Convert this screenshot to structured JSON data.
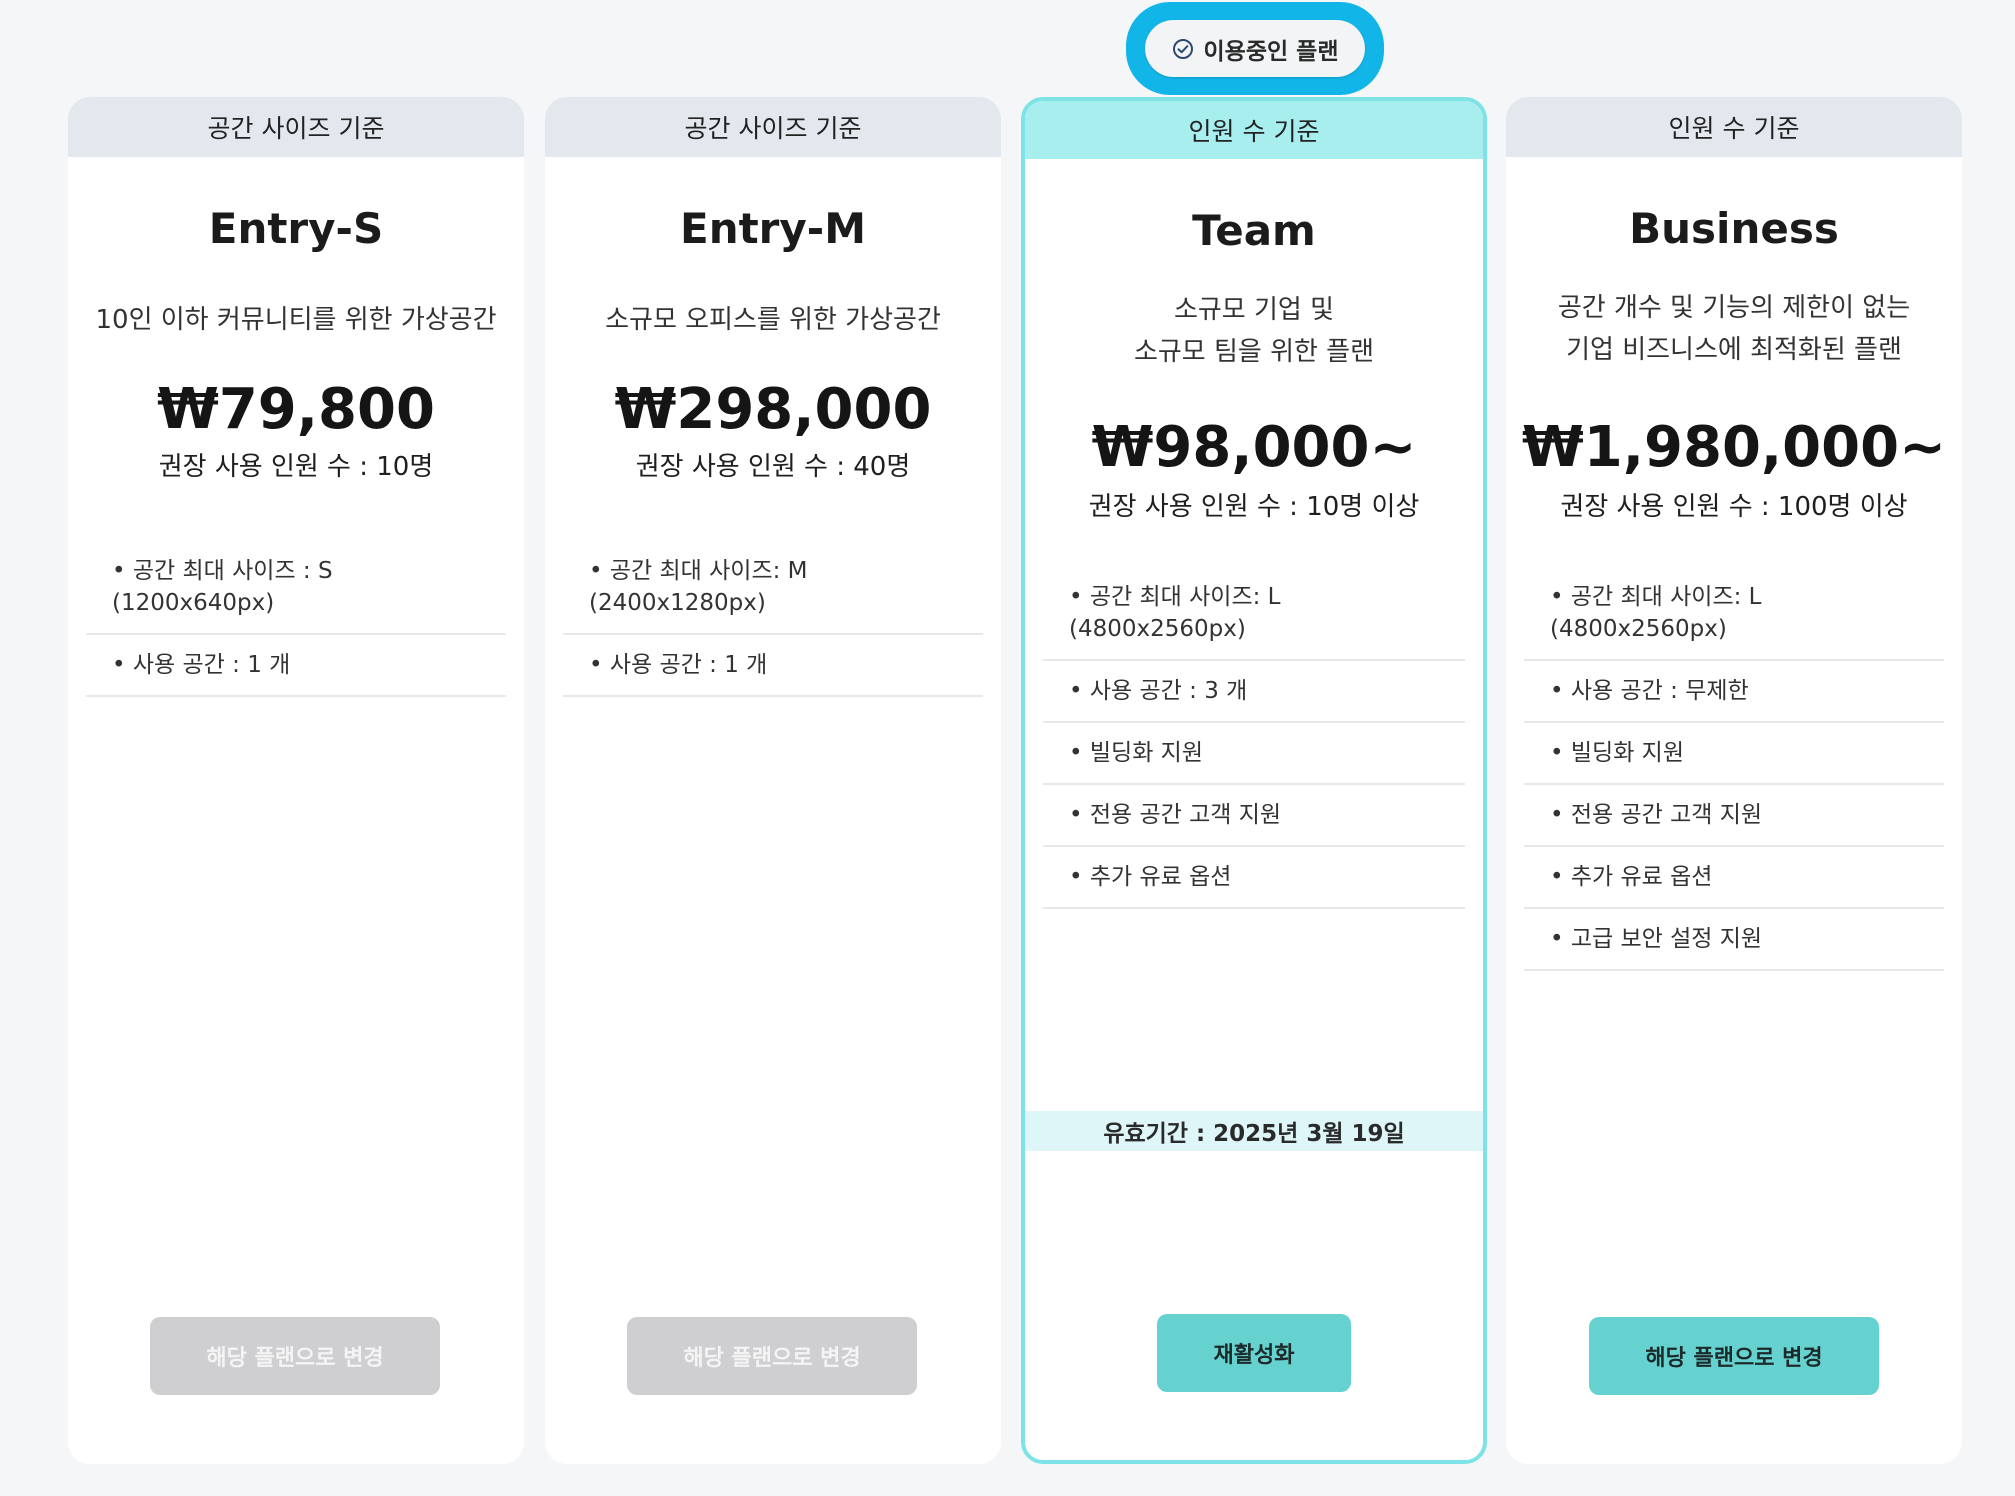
{
  "current_badge": {
    "label": "이용중인 플랜",
    "icon": "check-circle-icon"
  },
  "colors": {
    "accent": "#66d2d0",
    "active_border": "#7ee3e6",
    "badge_highlight": "#12b5e8",
    "header_default": "#e3e8ee",
    "header_active": "#a8eeee",
    "button_disabled": "#cfcfd2"
  },
  "plans": [
    {
      "category": "공간 사이즈 기준",
      "name": "Entry-S",
      "description": "10인 이하 커뮤니티를 위한 가상공간",
      "price": "₩79,800",
      "recommended": "권장 사용 인원 수 : 10명",
      "features": [
        "• 공간 최대 사이즈 : S\n(1200x640px)",
        "• 사용 공간 :  1 개"
      ],
      "button": {
        "label": "해당 플랜으로 변경",
        "state": "disabled"
      }
    },
    {
      "category": "공간 사이즈 기준",
      "name": "Entry-M",
      "description": "소규모 오피스를 위한 가상공간",
      "price": "₩298,000",
      "recommended": "권장 사용 인원 수 : 40명",
      "features": [
        "• 공간 최대 사이즈: M\n(2400x1280px)",
        "• 사용 공간 :  1 개"
      ],
      "button": {
        "label": "해당 플랜으로 변경",
        "state": "disabled"
      }
    },
    {
      "category": "인원 수 기준",
      "name": "Team",
      "description": "소규모 기업 및\n소규모 팀을 위한 플랜",
      "price": "₩98,000~",
      "recommended": "권장 사용 인원 수 : 10명 이상",
      "features": [
        "• 공간 최대 사이즈: L\n(4800x2560px)",
        "• 사용 공간 :  3 개",
        "• 빌딩화 지원",
        "• 전용 공간 고객 지원",
        "• 추가 유료 옵션"
      ],
      "validity": "유효기간 : 2025년 3월 19일",
      "button": {
        "label": "재활성화",
        "state": "primary"
      },
      "current": true
    },
    {
      "category": "인원 수 기준",
      "name": "Business",
      "description": "공간 개수 및 기능의 제한이 없는\n기업 비즈니스에 최적화된 플랜",
      "price": "₩1,980,000~",
      "recommended": "권장 사용 인원 수 : 100명 이상",
      "features": [
        "• 공간 최대 사이즈: L\n(4800x2560px)",
        "• 사용 공간 : 무제한",
        "• 빌딩화 지원",
        "• 전용 공간 고객 지원",
        "• 추가 유료 옵션",
        "• 고급 보안 설정 지원"
      ],
      "button": {
        "label": "해당 플랜으로 변경",
        "state": "primary"
      }
    }
  ]
}
